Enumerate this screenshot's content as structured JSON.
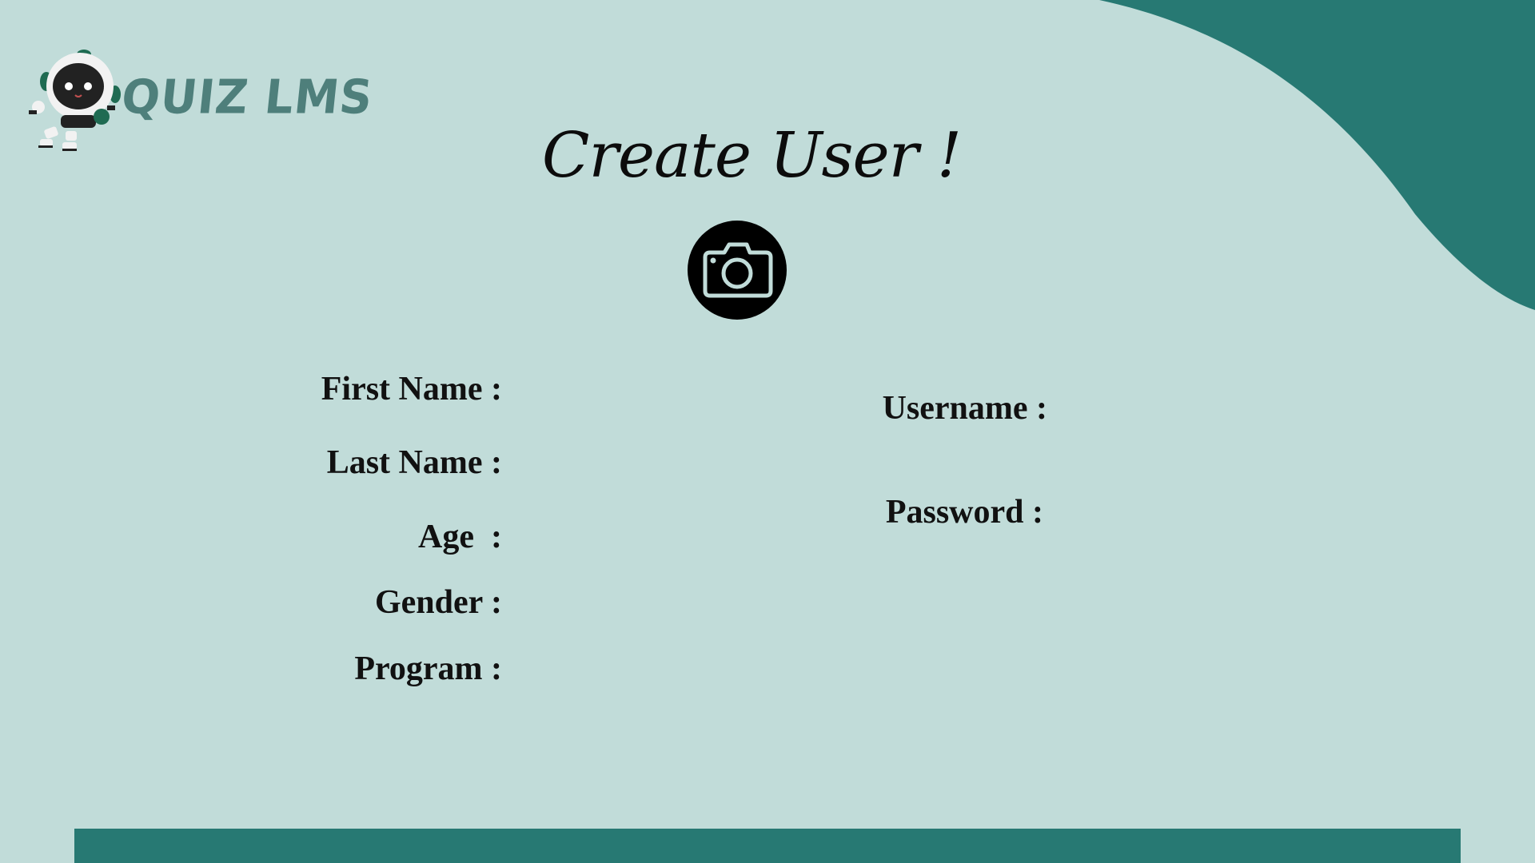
{
  "app": {
    "name": "QUIZ LMS"
  },
  "page": {
    "title": "Create User !"
  },
  "photo_upload": {
    "icon": "camera-icon"
  },
  "form": {
    "left_fields": [
      {
        "label": "First Name :",
        "value": ""
      },
      {
        "label": "Last Name :",
        "value": ""
      },
      {
        "label": "Age  :",
        "value": ""
      },
      {
        "label": "Gender :",
        "value": ""
      },
      {
        "label": "Program :",
        "value": ""
      }
    ],
    "right_fields": [
      {
        "label": "Username :",
        "value": ""
      },
      {
        "label": "Password :",
        "value": ""
      }
    ]
  },
  "colors": {
    "background": "#c1dcd9",
    "accent": "#277973",
    "logo_text": "#4e7f7b",
    "text": "#111111"
  }
}
